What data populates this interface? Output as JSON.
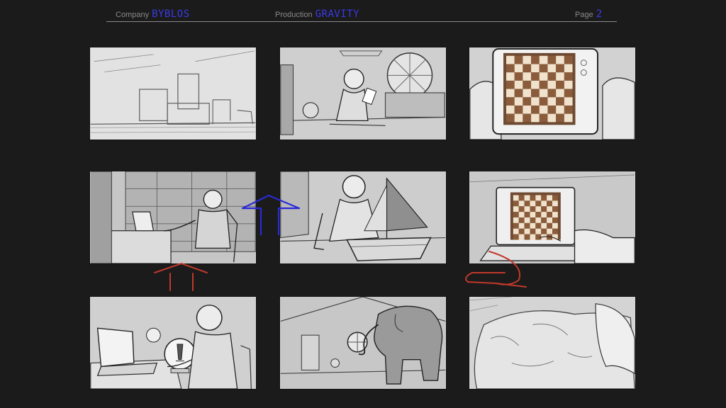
{
  "header": {
    "company_label": "Company",
    "company_value": "BYBLOS",
    "production_label": "Production",
    "production_value": "GRAVITY",
    "page_label": "Page",
    "page_value": "2"
  },
  "colors": {
    "background": "#1b1b1b",
    "header_label": "#8a8a8a",
    "header_value": "#3a3ae6",
    "arrow_blue": "#2a2ad6",
    "arrow_red": "#c0392b",
    "panel_fill": "#d7d7d7"
  },
  "panels": [
    {
      "id": 1,
      "scene": "empty-furniture-room"
    },
    {
      "id": 2,
      "scene": "boy-sitting-with-tablet"
    },
    {
      "id": 3,
      "scene": "hands-holding-chess-tablet"
    },
    {
      "id": 4,
      "scene": "man-at-desk-in-library"
    },
    {
      "id": 5,
      "scene": "boy-with-toy-sailboat"
    },
    {
      "id": 6,
      "scene": "laptop-chessboard-typing"
    },
    {
      "id": 7,
      "scene": "man-with-laptop-and-chess-globe"
    },
    {
      "id": 8,
      "scene": "elephant-in-attic-room"
    },
    {
      "id": 9,
      "scene": "elephant-closeup"
    }
  ]
}
